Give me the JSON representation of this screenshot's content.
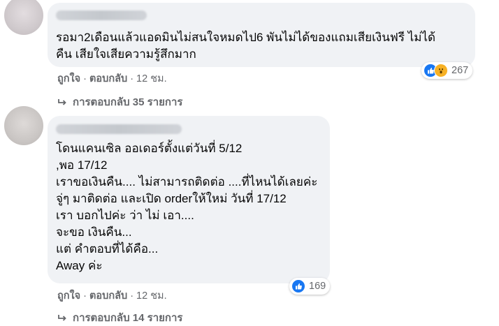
{
  "comments": [
    {
      "text": "รอมา2เดือนแล้วแอดมินไม่สนใจหมดไป6 พันไม่ได้ของแถมเสียเงินฟรี ไม่ได้\nคืน เสียใจเสียความรู้สึกมาก",
      "actions": {
        "like": "ถูกใจ",
        "reply": "ตอบกลับ",
        "time": "12 ชม."
      },
      "reactions": {
        "icons": [
          "like-icon",
          "wow-icon"
        ],
        "count": "267"
      },
      "replies": "การตอบกลับ 35 รายการ"
    },
    {
      "text": "โดนแคนเซิล ออเดอร์ตั้งแต่วันที่ 5/12\n,พอ 17/12\nเราขอเงินคืน.... ไม่สามารถติดต่อ ....ที่ไหนได้เลยค่ะ\nจู่ๆ มาติดต่อ และเปิด orderให้ใหม่ วันที่ 17/12\nเรา บอกไปค่ะ ว่า ไม่ เอา....\nจะขอ เงินคืน...\nแต่ คำตอบที่ได้คือ...\nAway ค่ะ",
      "actions": {
        "like": "ถูกใจ",
        "reply": "ตอบกลับ",
        "time": "12 ชม."
      },
      "reactions": {
        "icons": [
          "like-icon"
        ],
        "count": "169"
      },
      "replies": "การตอบกลับ 14 รายการ"
    }
  ],
  "colors": {
    "bubble": "#f0f2f5",
    "muted": "#65676b",
    "like": "#1877f2",
    "wow": "#f7b125"
  }
}
